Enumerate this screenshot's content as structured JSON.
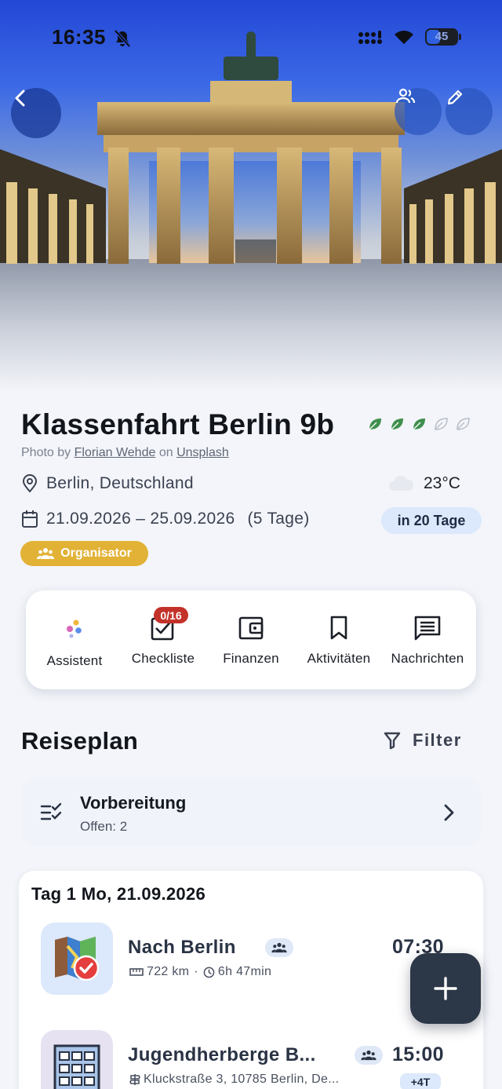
{
  "status_bar": {
    "time": "16:35",
    "battery": "45",
    "battery_level": 0.45
  },
  "hero": {
    "image": "brandenburg-gate-photo"
  },
  "trip": {
    "title": "Klassenfahrt Berlin 9b",
    "sustainability_leaves": {
      "filled": 3,
      "total": 5
    },
    "photo_credit": {
      "prefix": "Photo by",
      "author": "Florian Wehde",
      "connector": "on",
      "source": "Unsplash"
    },
    "location": "Berlin, Deutschland",
    "dates": "21.09.2026 – 25.09.2026",
    "duration": "(5 Tage)",
    "weather": {
      "temperature": "23°C",
      "icon": "cloud-icon"
    },
    "countdown": "in 20 Tage",
    "role": "Organisator"
  },
  "quick_actions": [
    {
      "label": "Assistent",
      "icon": "assistant-dots-icon"
    },
    {
      "label": "Checkliste",
      "icon": "checklist-icon",
      "badge": "0/16"
    },
    {
      "label": "Finanzen",
      "icon": "wallet-icon"
    },
    {
      "label": "Aktivitäten",
      "icon": "bookmark-icon"
    },
    {
      "label": "Nachrichten",
      "icon": "message-icon"
    }
  ],
  "plan": {
    "title": "Reiseplan",
    "filter_label": "Filter",
    "preparation": {
      "title": "Vorbereitung",
      "subtitle": "Offen: 2"
    },
    "days": [
      {
        "title": "Tag 1 Mo, 21.09.2026",
        "items": [
          {
            "title": "Nach Berlin",
            "distance": "722 km",
            "separator": "·",
            "duration": "6h 47min",
            "time": "07:30",
            "icon": "route-map-icon"
          },
          {
            "title": "Jugendherberge B...",
            "address": "Kluckstraße 3, 10785 Berlin, De...",
            "time": "15:00",
            "extra": "+4T",
            "icon": "hotel-building-icon"
          }
        ]
      }
    ]
  },
  "colors": {
    "accent_gold": "#e2b236",
    "badge_red": "#c3322a",
    "leaf_green": "#3f8f4e",
    "fab_dark": "#2c3747",
    "chip_blue": "#dce8fb"
  }
}
